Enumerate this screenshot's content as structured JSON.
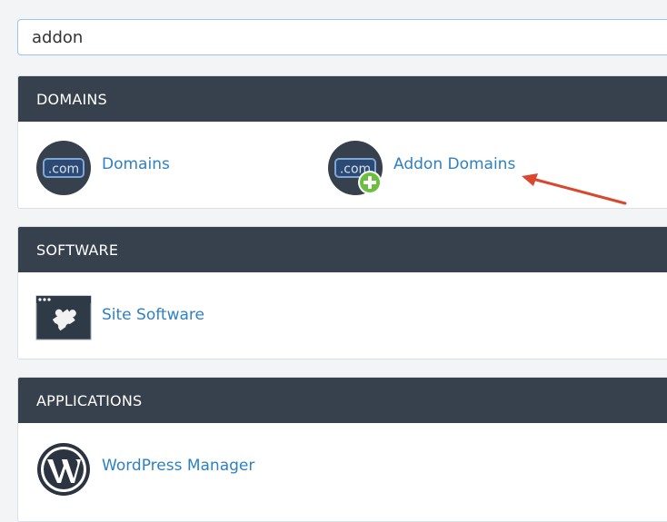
{
  "search": {
    "value": "addon"
  },
  "sections": [
    {
      "title": "DOMAINS",
      "items": [
        {
          "label": "Domains",
          "icon": "dotcom-icon"
        },
        {
          "label": "Addon Domains",
          "icon": "dotcom-add-icon"
        }
      ]
    },
    {
      "title": "SOFTWARE",
      "items": [
        {
          "label": "Site Software",
          "icon": "puzzle-window-icon"
        }
      ]
    },
    {
      "title": "APPLICATIONS",
      "items": [
        {
          "label": "WordPress Manager",
          "icon": "wordpress-icon"
        }
      ]
    }
  ],
  "icon_text": {
    "dotcom": ".com"
  },
  "colors": {
    "header_bg": "#37414d",
    "link": "#2f80c2",
    "arrow": "#d9472f",
    "plus_badge": "#6cbf3e"
  }
}
